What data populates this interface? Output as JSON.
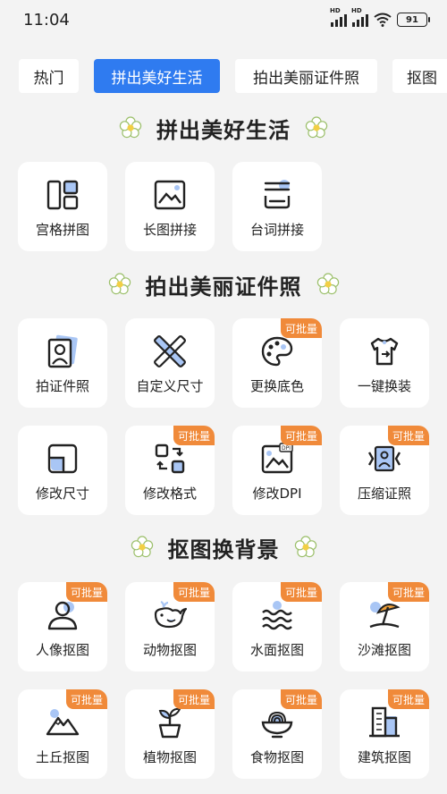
{
  "status": {
    "time": "11:04",
    "hd1": "HD",
    "hd2": "HD",
    "battery": "91"
  },
  "tabs": [
    {
      "label": "热门"
    },
    {
      "label": "拼出美好生活"
    },
    {
      "label": "拍出美丽证件照"
    },
    {
      "label": "抠图"
    }
  ],
  "sections": [
    {
      "title": "拼出美好生活"
    },
    {
      "title": "拍出美丽证件照"
    },
    {
      "title": "抠图换背景"
    }
  ],
  "badge_label": "可批量",
  "cards": [
    {
      "label": "宫格拼图",
      "icon": "grid-collage-icon"
    },
    {
      "label": "长图拼接",
      "icon": "long-image-icon"
    },
    {
      "label": "台词拼接",
      "icon": "subtitle-stitch-icon"
    },
    {
      "label": "拍证件照",
      "icon": "id-photo-icon"
    },
    {
      "label": "自定义尺寸",
      "icon": "ruler-pencil-icon"
    },
    {
      "label": "更换底色",
      "icon": "palette-icon"
    },
    {
      "label": "一键换装",
      "icon": "shirt-swap-icon"
    },
    {
      "label": "修改尺寸",
      "icon": "resize-icon"
    },
    {
      "label": "修改格式",
      "icon": "format-convert-icon"
    },
    {
      "label": "修改DPI",
      "icon": "dpi-icon"
    },
    {
      "label": "压缩证照",
      "icon": "compress-icon"
    },
    {
      "label": "人像抠图",
      "icon": "portrait-icon"
    },
    {
      "label": "动物抠图",
      "icon": "whale-icon"
    },
    {
      "label": "水面抠图",
      "icon": "water-icon"
    },
    {
      "label": "沙滩抠图",
      "icon": "beach-umbrella-icon"
    },
    {
      "label": "土丘抠图",
      "icon": "mountain-icon"
    },
    {
      "label": "植物抠图",
      "icon": "plant-icon"
    },
    {
      "label": "食物抠图",
      "icon": "food-bowl-icon"
    },
    {
      "label": "建筑抠图",
      "icon": "building-icon"
    }
  ],
  "colors": {
    "accent": "#2f7bf0",
    "badge": "#f08a3a",
    "background": "#f3f3f3",
    "icon_highlight": "#a9c6f5"
  }
}
